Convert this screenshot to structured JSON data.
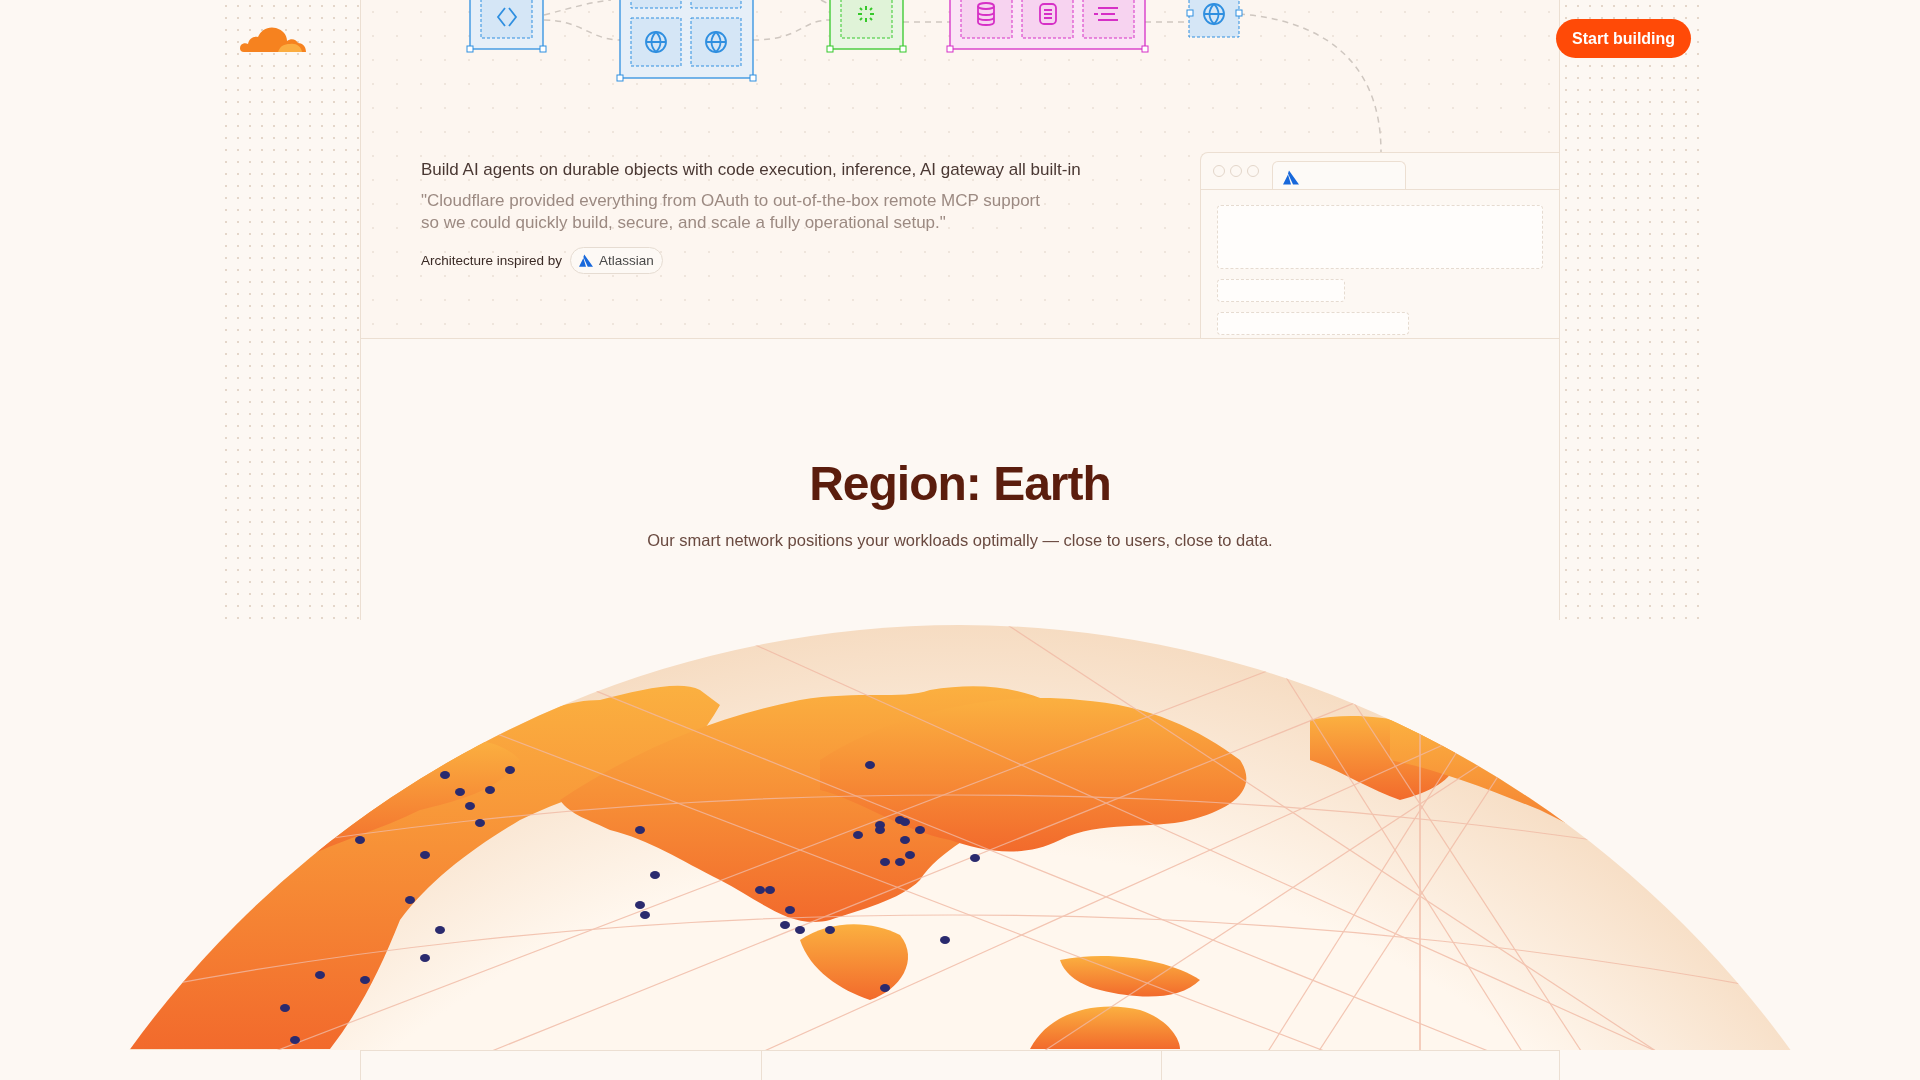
{
  "header": {
    "button": "Start building"
  },
  "feature": {
    "headline": "Build AI agents on durable objects with code execution, inference, AI gateway all built-in",
    "quote": "\"Cloudflare provided everything from OAuth to out-of-the-box remote MCP support so we could quickly build, secure, and scale a fully operational setup.\"",
    "attribution": "Architecture inspired by",
    "partner": "Atlassian"
  },
  "section": {
    "title": "Region: Earth",
    "subtitle": "Our smart network positions your workloads optimally — close to users, close to data."
  }
}
